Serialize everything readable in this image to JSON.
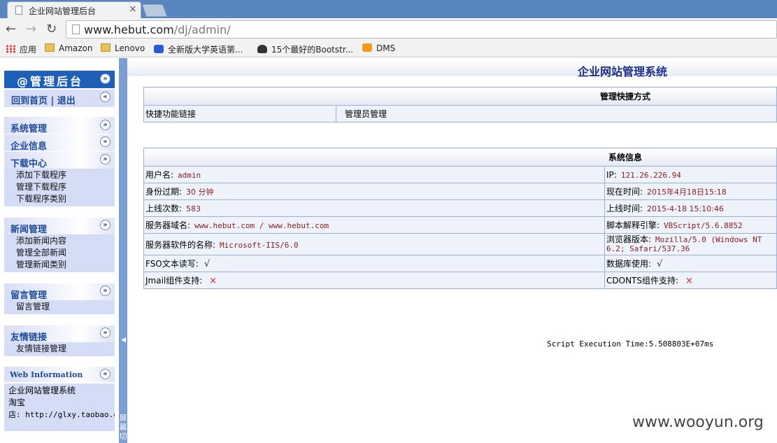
{
  "browser": {
    "tab_title": "企业网站管理后台",
    "tab_close": "×",
    "url_host": "www.hebut.com",
    "url_path": "/dj/admin/",
    "bookmarks": [
      "应用",
      "Amazon",
      "Lenovo",
      "全新版大学英语第...",
      "15个最好的Bootstr...",
      "DMS"
    ]
  },
  "sidebar": {
    "header": "@管理后台",
    "links": "回到首页 | 退出",
    "sections": [
      {
        "title": "系统管理",
        "items": []
      },
      {
        "title": "企业信息",
        "items": []
      },
      {
        "title": "下载中心",
        "items": [
          "添加下载程序",
          "管理下载程序",
          "下载程序类别"
        ]
      },
      {
        "title": "新闻管理",
        "items": [
          "添加新闻内容",
          "管理全部新闻",
          "管理新闻类别"
        ]
      },
      {
        "title": "留言管理",
        "items": [
          "留言管理"
        ]
      },
      {
        "title": "友情链接",
        "items": [
          "友情链接管理"
        ]
      }
    ],
    "web_info_title": "Web Information",
    "web_info_lines": [
      "企业网站管理系统",
      "淘宝",
      "店: http://glxy.taobao.com"
    ],
    "switch_text": "屏幕切"
  },
  "main": {
    "title": "企业网站管理系统",
    "shortcuts": {
      "title": "管理快捷方式",
      "col1": "快捷功能链接",
      "col2": "管理员管理"
    },
    "sysinfo": {
      "title": "系统信息",
      "rows": [
        {
          "l_label": "用户名:",
          "l_val": "admin",
          "r_label": "IP:",
          "r_val": "121.26.226.94"
        },
        {
          "l_label": "身份过期:",
          "l_val": "30 分钟",
          "r_label": "现在时间:",
          "r_val": "2015年4月18日15:18"
        },
        {
          "l_label": "上线次数:",
          "l_val": "583",
          "r_label": "上线时间:",
          "r_val": "2015-4-18 15:10:46"
        },
        {
          "l_label": "服务器域名:",
          "l_val": "www.hebut.com / www.hebut.com",
          "r_label": "脚本解释引擎:",
          "r_val": "VBScript/5.6.8852"
        },
        {
          "l_label": "服务器软件的名称:",
          "l_val": "Microsoft-IIS/6.0",
          "r_label": "浏览器版本:",
          "r_val": "Mozilla/5.0 (Windows NT 6.2; Safari/537.36"
        },
        {
          "l_label": "FSO文本读写:",
          "l_val": "√",
          "r_label": "数据库使用:",
          "r_val": "√"
        },
        {
          "l_label": "Jmail组件支持:",
          "l_val": "×",
          "r_label": "CDONTS组件支持:",
          "r_val": "×"
        }
      ]
    },
    "exec_time": "Script Execution Time:5.508803E+07ms"
  },
  "watermark": "www.wooyun.org"
}
